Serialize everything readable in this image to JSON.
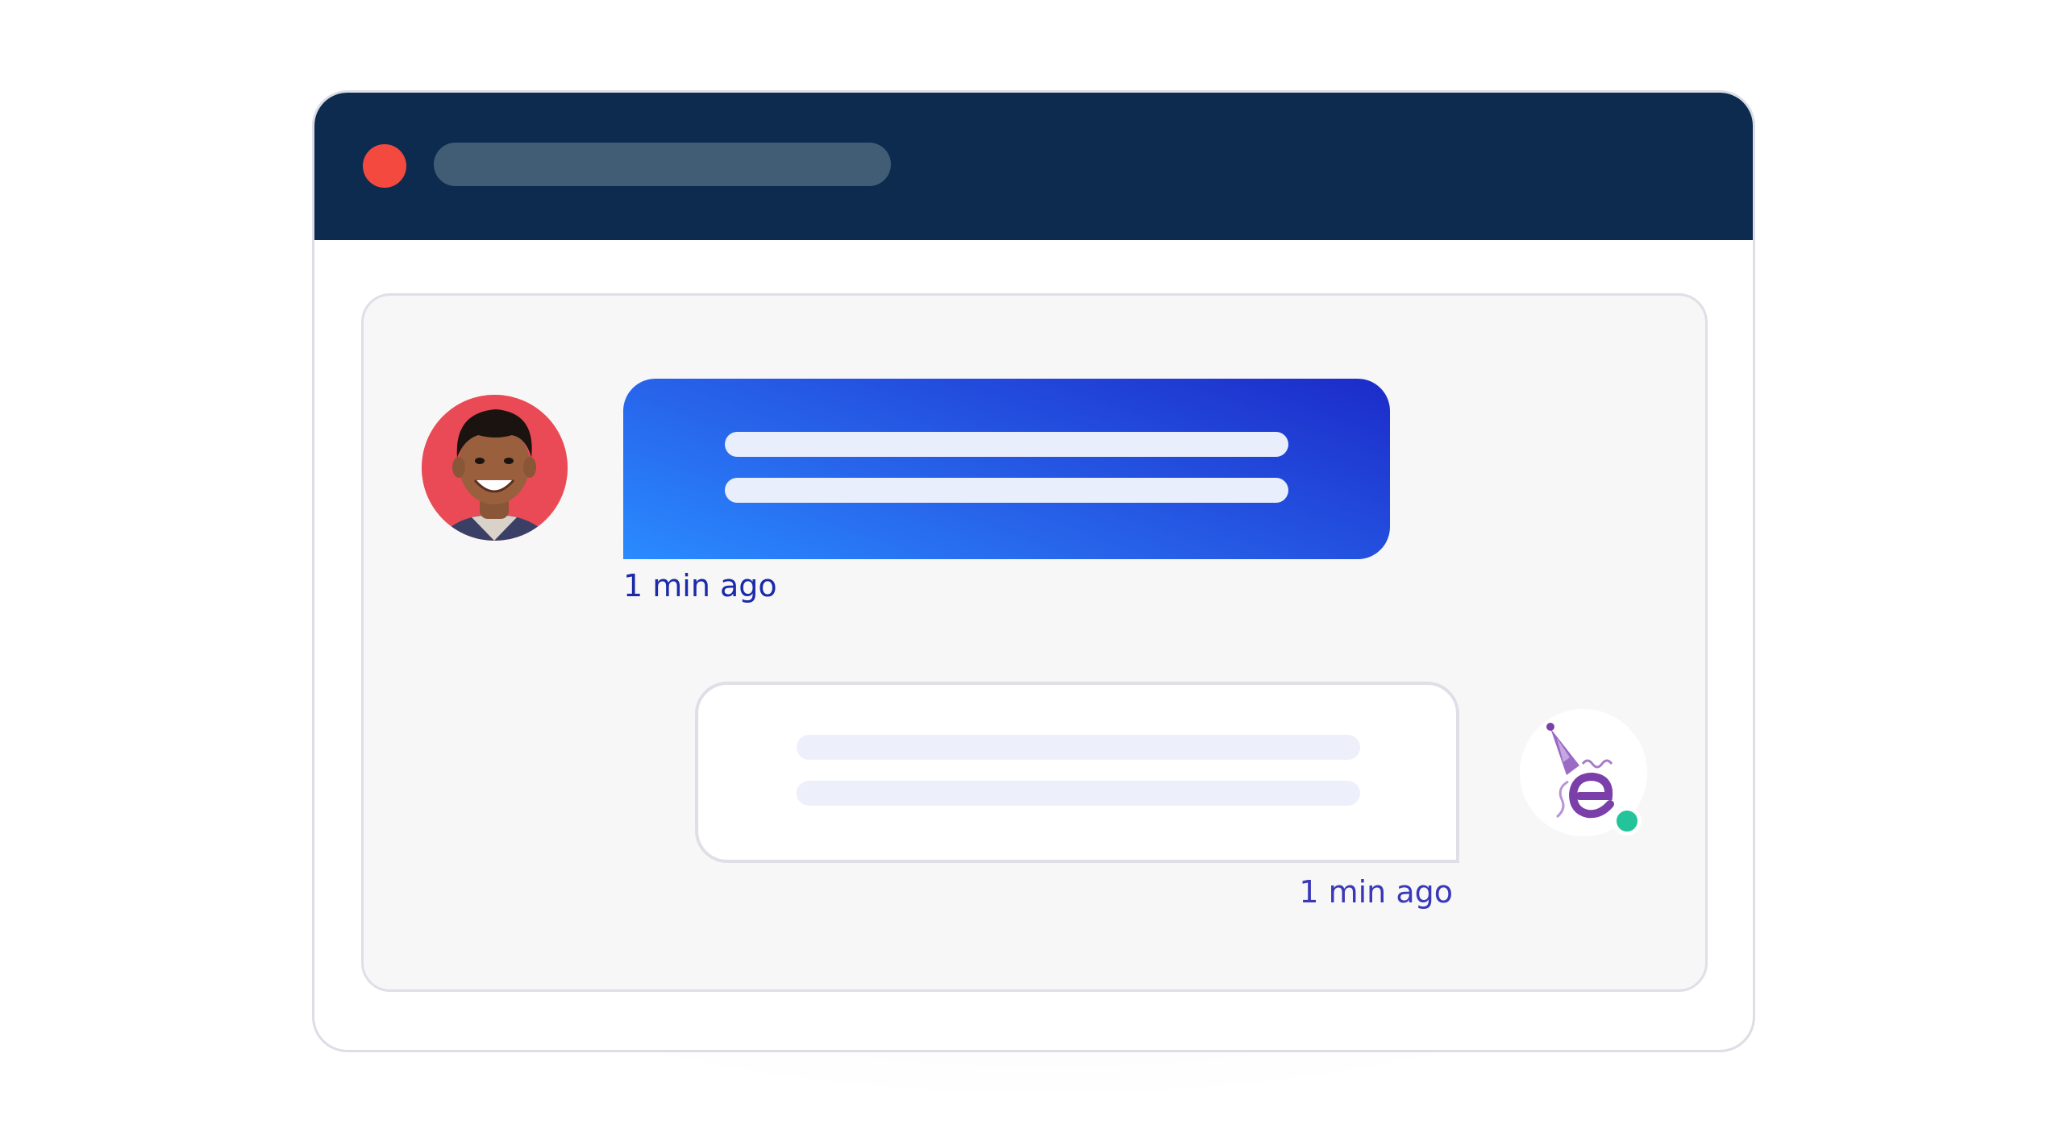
{
  "window": {
    "title_bar_color": "#0c2b4f",
    "close_button_color": "#f4493f",
    "address_bar_color": "#415d76"
  },
  "messages": [
    {
      "direction": "incoming",
      "sender_avatar": "user-photo",
      "bubble_color": "#2763ea",
      "time": "1 min ago"
    },
    {
      "direction": "outgoing",
      "sender_avatar": "brand-logo-e",
      "bubble_color": "#ffffff",
      "time": "1 min ago",
      "status": "online",
      "status_color": "#24c49a"
    }
  ]
}
